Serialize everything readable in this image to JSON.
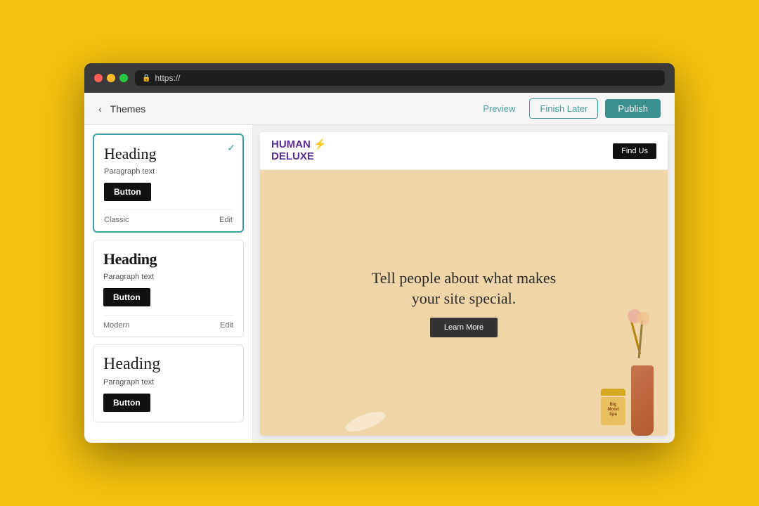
{
  "browser": {
    "address": "https://"
  },
  "header": {
    "title": "Themes",
    "back_label": "‹",
    "preview_label": "Preview",
    "finish_later_label": "Finish Later",
    "publish_label": "Publish"
  },
  "sidebar": {
    "themes": [
      {
        "id": "classic",
        "heading": "Heading",
        "heading_style": "normal",
        "paragraph": "Paragraph text",
        "button_label": "Button",
        "name": "Classic",
        "edit_label": "Edit",
        "active": true
      },
      {
        "id": "modern",
        "heading": "Heading",
        "heading_style": "bold",
        "paragraph": "Paragraph text",
        "button_label": "Button",
        "name": "Modern",
        "edit_label": "Edit",
        "active": false
      },
      {
        "id": "minimal",
        "heading": "Heading",
        "heading_style": "normal",
        "paragraph": "Paragraph text",
        "button_label": "Button",
        "name": "",
        "edit_label": "",
        "active": false
      }
    ]
  },
  "site_preview": {
    "logo_line1": "HUMAN ⚡",
    "logo_line2": "DELUXE",
    "find_us_label": "Find Us",
    "hero_title": "Tell people about what makes your site special.",
    "hero_cta_label": "Learn More"
  }
}
